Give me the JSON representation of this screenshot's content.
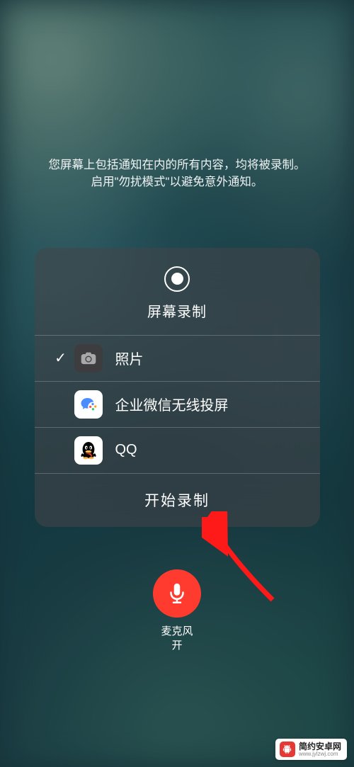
{
  "notice": {
    "line1": "您屏幕上包括通知在内的所有内容，均将被录制。",
    "line2": "启用\"勿扰模式\"以避免意外通知。"
  },
  "card": {
    "title": "屏幕录制",
    "options": [
      {
        "label": "照片",
        "selected": true,
        "icon": "camera"
      },
      {
        "label": "企业微信无线投屏",
        "selected": false,
        "icon": "wechat-work"
      },
      {
        "label": "QQ",
        "selected": false,
        "icon": "qq"
      }
    ],
    "start_button": "开始录制"
  },
  "mic": {
    "label_line1": "麦克风",
    "label_line2": "开",
    "state": "on"
  },
  "watermark": {
    "name": "简约安卓网",
    "url": "www.jylzwj.com"
  }
}
